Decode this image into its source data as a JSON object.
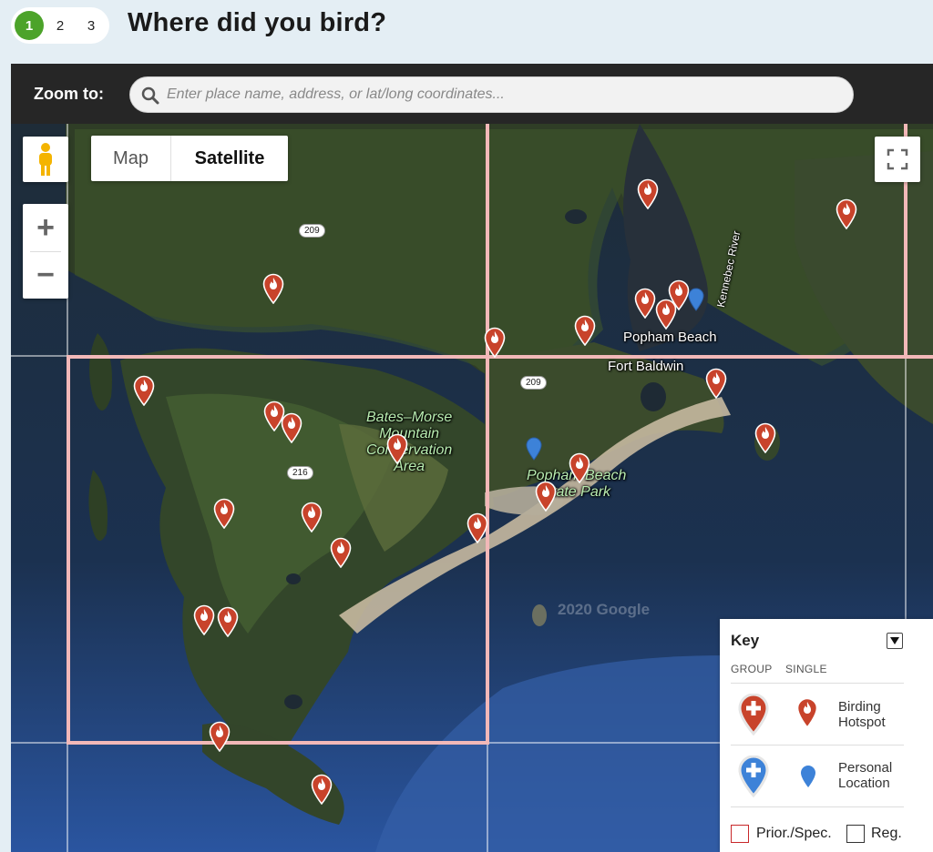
{
  "steps": [
    "1",
    "2",
    "3"
  ],
  "active_step": "1",
  "title": "Where did you bird?",
  "zoom": {
    "label": "Zoom to:",
    "placeholder": "Enter place name, address, or lat/long coordinates..."
  },
  "map_controls": {
    "map_type_map": "Map",
    "map_type_satellite": "Satellite",
    "selected_type": "Satellite",
    "zoom_in": "+",
    "zoom_out": "−"
  },
  "map_labels": {
    "popham_beach": "Popham Beach",
    "fort_baldwin": "Fort Baldwin",
    "popham_beach_state_park_1": "Popham Beach",
    "popham_beach_state_park_2": "State Park",
    "bates_morse_1": "Bates–Morse",
    "bates_morse_2": "Mountain",
    "bates_morse_3": "Conservation",
    "bates_morse_4": "Area",
    "kennebec_river": "Kennebec River",
    "route_209_a": "209",
    "route_209_b": "209",
    "route_216": "216",
    "copyright": "2020 Google"
  },
  "key": {
    "title": "Key",
    "col_group": "GROUP",
    "col_single": "SINGLE",
    "hotspot_1": "Birding",
    "hotspot_2": "Hotspot",
    "personal_1": "Personal",
    "personal_2": "Location",
    "prior_spec": "Prior./Spec.",
    "reg": "Reg."
  },
  "colors": {
    "hotspot_pin": "#c8432b",
    "personal_pin": "#3d82d8",
    "grid_highlight": "#f2b8b8",
    "active_step": "#4ca32a"
  }
}
